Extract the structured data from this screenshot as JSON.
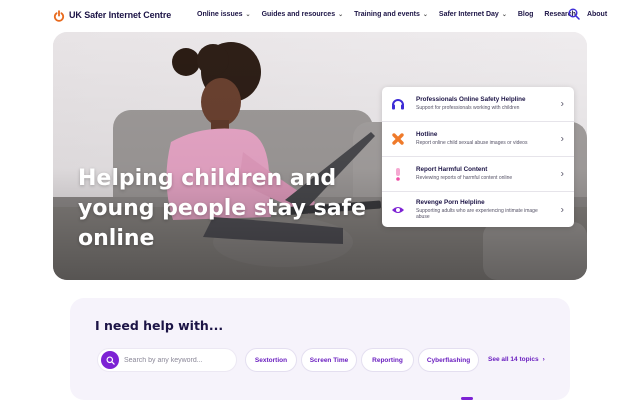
{
  "brand": {
    "name": "UK Safer Internet Centre",
    "accent": "#e86a1e",
    "primary": "#7d22d4",
    "navy": "#1c1446"
  },
  "nav": {
    "items": [
      {
        "label": "Online issues",
        "dropdown": true
      },
      {
        "label": "Guides and resources",
        "dropdown": true
      },
      {
        "label": "Training and events",
        "dropdown": true
      },
      {
        "label": "Safer Internet Day",
        "dropdown": true
      },
      {
        "label": "Blog",
        "dropdown": false
      },
      {
        "label": "Research",
        "dropdown": false
      },
      {
        "label": "About",
        "dropdown": false
      }
    ],
    "search_icon": "search-icon"
  },
  "hero": {
    "title": "Helping children and young people stay safe online",
    "helplines": [
      {
        "title": "Professionals Online Safety Helpline",
        "desc": "Support for professionals working with children",
        "icon": "headset-icon",
        "color": "#3d2cd6"
      },
      {
        "title": "Hotline",
        "desc": "Report online child sexual abuse images or videos",
        "icon": "cross-icon",
        "color": "#ef7a2a"
      },
      {
        "title": "Report Harmful Content",
        "desc": "Reviewing reports of harmful content online",
        "icon": "exclamation-icon",
        "color": "#ef4fa6"
      },
      {
        "title": "Revenge Porn Helpline",
        "desc": "Supporting adults who are experiencing intimate image abuse",
        "icon": "eye-icon",
        "color": "#7d22d4"
      }
    ]
  },
  "help": {
    "title": "I need help with...",
    "search_placeholder": "Search by any keyword...",
    "topics": [
      "Sextortion",
      "Screen Time",
      "Reporting",
      "Cyberflashing"
    ],
    "see_all": "See all 14 topics"
  }
}
